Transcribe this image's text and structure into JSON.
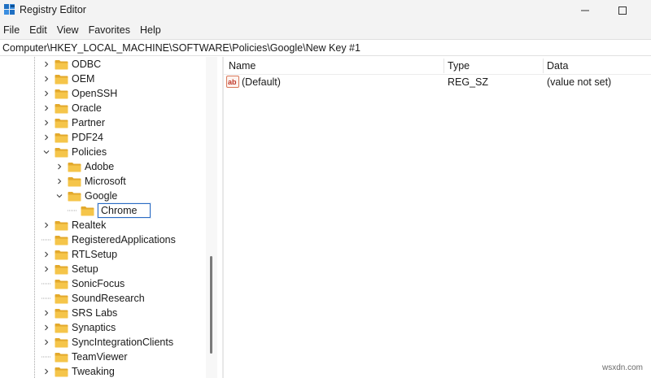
{
  "window": {
    "title": "Registry Editor",
    "icon": "registry-icon"
  },
  "menu": [
    "File",
    "Edit",
    "View",
    "Favorites",
    "Help"
  ],
  "address": "Computer\\HKEY_LOCAL_MACHINE\\SOFTWARE\\Policies\\Google\\New Key #1",
  "tree": {
    "nodes": [
      {
        "label": "ODBC",
        "expander": "collapsed",
        "level": 1
      },
      {
        "label": "OEM",
        "expander": "collapsed",
        "level": 1
      },
      {
        "label": "OpenSSH",
        "expander": "collapsed",
        "level": 1
      },
      {
        "label": "Oracle",
        "expander": "collapsed",
        "level": 1
      },
      {
        "label": "Partner",
        "expander": "collapsed",
        "level": 1
      },
      {
        "label": "PDF24",
        "expander": "collapsed",
        "level": 1
      },
      {
        "label": "Policies",
        "expander": "expanded",
        "level": 1
      },
      {
        "label": "Adobe",
        "expander": "collapsed",
        "level": 2
      },
      {
        "label": "Microsoft",
        "expander": "collapsed",
        "level": 2
      },
      {
        "label": "Google",
        "expander": "expanded",
        "level": 2
      },
      {
        "label": "Chrome",
        "expander": "none",
        "level": 3,
        "editing": true
      },
      {
        "label": "Realtek",
        "expander": "collapsed",
        "level": 1
      },
      {
        "label": "RegisteredApplications",
        "expander": "none",
        "level": 1
      },
      {
        "label": "RTLSetup",
        "expander": "collapsed",
        "level": 1
      },
      {
        "label": "Setup",
        "expander": "collapsed",
        "level": 1
      },
      {
        "label": "SonicFocus",
        "expander": "none",
        "level": 1
      },
      {
        "label": "SoundResearch",
        "expander": "none",
        "level": 1
      },
      {
        "label": "SRS Labs",
        "expander": "collapsed",
        "level": 1
      },
      {
        "label": "Synaptics",
        "expander": "collapsed",
        "level": 1
      },
      {
        "label": "SyncIntegrationClients",
        "expander": "collapsed",
        "level": 1
      },
      {
        "label": "TeamViewer",
        "expander": "none",
        "level": 1
      },
      {
        "label": "Tweaking",
        "expander": "collapsed",
        "level": 1
      }
    ]
  },
  "values_list": {
    "columns": {
      "name": "Name",
      "type": "Type",
      "data": "Data"
    },
    "rows": [
      {
        "name": "(Default)",
        "type": "REG_SZ",
        "data": "(value not set)",
        "icon": "string-value-icon"
      }
    ]
  },
  "watermark": "wsxdn.com",
  "colors": {
    "folder": "#f5c54a",
    "folder_dark": "#e3a92c",
    "selection_border": "#2b6cc4"
  }
}
